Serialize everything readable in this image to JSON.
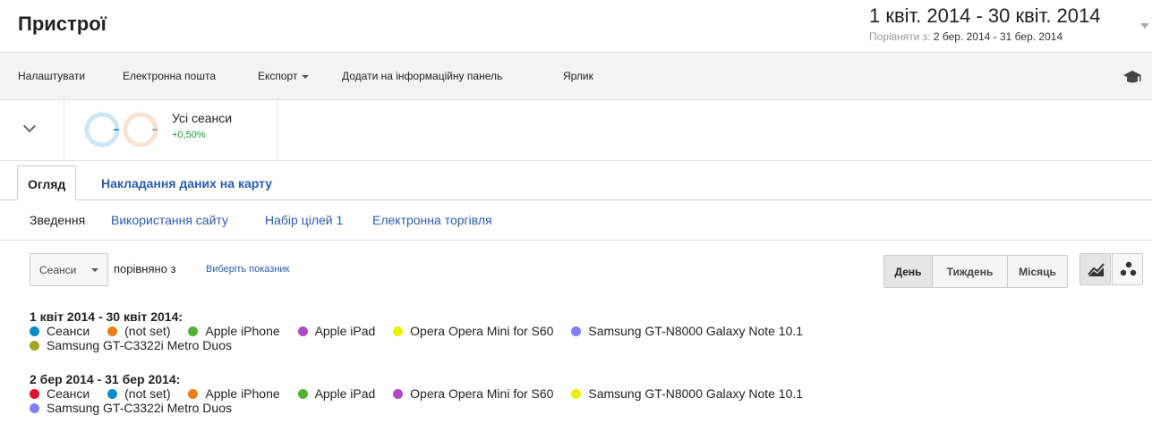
{
  "page": {
    "title": "Пристрої"
  },
  "daterange": {
    "main": "1 квіт. 2014 - 30 квіт. 2014",
    "compare_prefix": "Порівняти з:",
    "compare_range": "2 бер. 2014 - 31 бер. 2014"
  },
  "toolbar": {
    "customize": "Налаштувати",
    "email": "Електронна пошта",
    "export": "Експорт",
    "add_dashboard": "Додати на інформаційну панель",
    "shortcut": "Ярлик",
    "cap_icon": "graduation-cap-icon"
  },
  "segment": {
    "name": "Усі сеанси",
    "change": "+0,50%",
    "ring_colors": [
      "#cde6f5",
      "#fbe3d2"
    ]
  },
  "tabs": {
    "overview": "Огляд",
    "map_overlay": "Накладання даних на карту"
  },
  "subnav": {
    "summary": "Зведення",
    "site_usage": "Використання сайту",
    "goal_set": "Набір цілей 1",
    "ecommerce": "Електронна торгівля"
  },
  "controls": {
    "metric": "Сеанси",
    "compared_with": "порівняно з",
    "pick_metric": "Виберіть показник",
    "day": "День",
    "week": "Тиждень",
    "month": "Місяць"
  },
  "legend": {
    "period1": {
      "heading": "1 квіт 2014 - 30 квіт 2014:",
      "items": [
        {
          "label": "Сеанси",
          "color": "#058dc7"
        },
        {
          "label": "(not set)",
          "color": "#ed7e17"
        },
        {
          "label": "Apple iPhone",
          "color": "#50b432"
        },
        {
          "label": "Apple iPad",
          "color": "#af49c5"
        },
        {
          "label": "Opera Opera Mini for S60",
          "color": "#edef00"
        },
        {
          "label": "Samsung GT-N8000 Galaxy Note 10.1",
          "color": "#8080ff"
        },
        {
          "label": "Samsung GT-C3322i Metro Duos",
          "color": "#a0a424"
        }
      ]
    },
    "period2": {
      "heading": "2 бер 2014 - 31 бер 2014:",
      "items": [
        {
          "label": "Сеанси",
          "color": "#e0102a"
        },
        {
          "label": "(not set)",
          "color": "#058dc7"
        },
        {
          "label": "Apple iPhone",
          "color": "#ed7e17"
        },
        {
          "label": "Apple iPad",
          "color": "#50b432"
        },
        {
          "label": "Opera Opera Mini for S60",
          "color": "#af49c5"
        },
        {
          "label": "Samsung GT-N8000 Galaxy Note 10.1",
          "color": "#edef00"
        },
        {
          "label": "Samsung GT-C3322i Metro Duos",
          "color": "#8080ff"
        }
      ]
    }
  }
}
